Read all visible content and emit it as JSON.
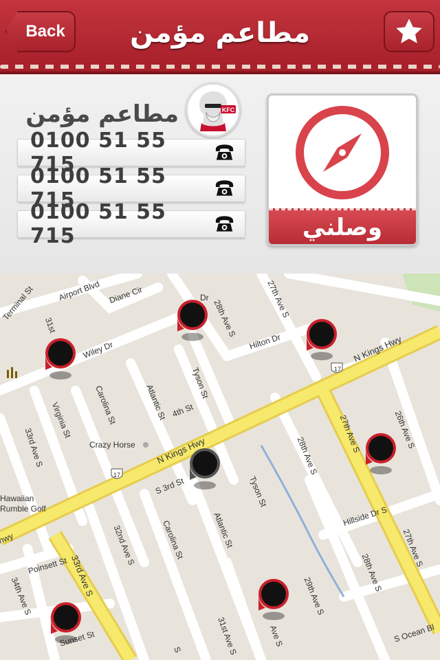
{
  "header": {
    "back_label": "Back",
    "title": "مطاعم مؤمن",
    "favorite_icon": "star-icon"
  },
  "restaurant": {
    "name": "مطاعم مؤمن",
    "logo_text": "KFC",
    "phones": [
      "0100 51 55 715",
      "0100 51 55 715",
      "0100 51 55 715"
    ],
    "phone_icon": "telephone-icon"
  },
  "navigate": {
    "label": "وصلني",
    "icon": "compass-icon"
  },
  "map": {
    "labels": {
      "terminal_st": "Terminal St",
      "airport_blvd": "Airport Blvd",
      "diane_cir": "Diane Cir",
      "dr": "Dr",
      "ave_28th_s_top": "28th Ave S",
      "ave_27th_s_top": "27th Ave S",
      "hilton_dr": "Hilton Dr",
      "st_31st": "31st",
      "wiley_dr": "Wiley Dr",
      "n_kings_hwy_right": "N Kings Hwy",
      "hwy17_shield_right": "17",
      "tyson_st_top": "Tyson St",
      "atlantic_st_top": "Atlantic St",
      "carolina_st_top": "Carolina St",
      "st_4th": "4th St",
      "virginia_st": "Virginia St",
      "ave_33rd_s_left": "33rd Ave S",
      "crazy_horse": "Crazy Horse",
      "n_kings_hwy_center": "N Kings Hwy",
      "ave_27th_s_mid": "27th Ave S",
      "ave_26th_s": "26th Ave S",
      "ave_28th_s_mid": "28th Ave S",
      "hwy17_shield_left": "17",
      "s_3rd_st": "S 3rd St",
      "tyson_st_mid": "Tyson St",
      "hawaiian_rumble_golf": "Hawaiian\nRumble Golf",
      "hwy_left": "hwy",
      "hillside_dr_s": "Hillside Dr S",
      "ave_32nd_s": "32nd Ave S",
      "carolina_st_low": "Carolina St",
      "atlantic_st_low": "Atlantic St",
      "ave_27th_s_low": "27th Ave S",
      "ave_33rd_s_low": "33rd Ave S",
      "poinsett_st": "Poinsett St",
      "ave_28th_s_low": "28th Ave S",
      "ave_34th_s": "34th Ave S",
      "ave_29th_s": "29th Ave S",
      "s_ocean_blvd": "S Ocean Bl",
      "sunset_st": "Sunset St",
      "ave_31st_s": "31st Ave S",
      "ave_s_bottom": "Ave S",
      "s_cut": "S"
    },
    "pin_icon": "map-pin-icon"
  },
  "colors": {
    "brand_red": "#b82c36",
    "highway_yellow": "#f6e96c",
    "map_bg": "#e8e4dc"
  }
}
